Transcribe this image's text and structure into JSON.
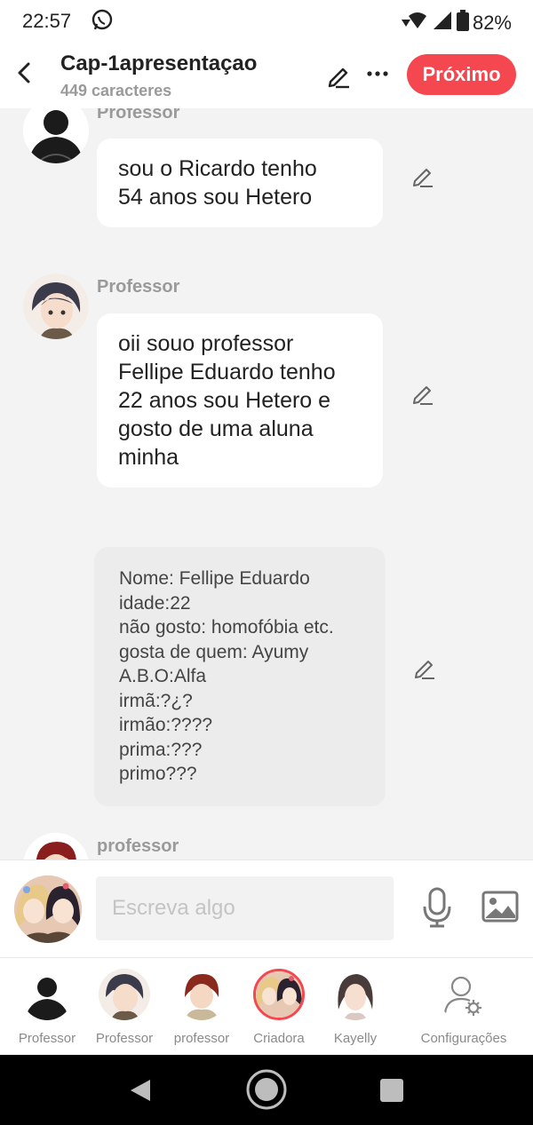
{
  "status_bar": {
    "time": "22:57",
    "battery": "82%",
    "icons": [
      "whatsapp-icon",
      "wifi-icon",
      "signal-icon",
      "battery-icon"
    ]
  },
  "header": {
    "title": "Cap-1apresentaçao",
    "subtitle": "449 caracteres",
    "next_label": "Próximo",
    "accent_color": "#f4474f"
  },
  "messages": [
    {
      "sender": "Professor",
      "avatar": "dark-silhouette",
      "lines": [
        "sou o Ricardo tenho",
        "54 anos sou Hetero"
      ]
    },
    {
      "sender": "Professor",
      "avatar": "anime-boy-dark-hair",
      "lines": [
        "oii souo professor",
        "Fellipe Eduardo tenho",
        "22 anos sou Hetero e",
        "gosto de uma aluna",
        "minha"
      ]
    },
    {
      "sender": "",
      "avatar": "",
      "narration": true,
      "lines": [
        "Nome: Fellipe Eduardo",
        "idade:22",
        "não gosto: homofóbia etc.",
        "gosta de quem: Ayumy",
        "A.B.O:Alfa",
        "irmã:?¿?",
        "irmão:????",
        "prima:???",
        "primo???"
      ]
    },
    {
      "sender": "professor",
      "avatar": "anime-boy-red-hair",
      "lines": []
    }
  ],
  "composer": {
    "placeholder": "Escreva algo",
    "value": ""
  },
  "characters": [
    {
      "label": "Professor",
      "avatar": "dark-silhouette",
      "selected": false
    },
    {
      "label": "Professor",
      "avatar": "anime-boy-dark-hair",
      "selected": false
    },
    {
      "label": "professor",
      "avatar": "anime-boy-red-hair",
      "selected": false
    },
    {
      "label": "Criadora",
      "avatar": "two-anime-girls",
      "selected": true
    },
    {
      "label": "Kayelly",
      "avatar": "anime-girl-dark-hair",
      "selected": false
    }
  ],
  "settings_label": "Configurações"
}
